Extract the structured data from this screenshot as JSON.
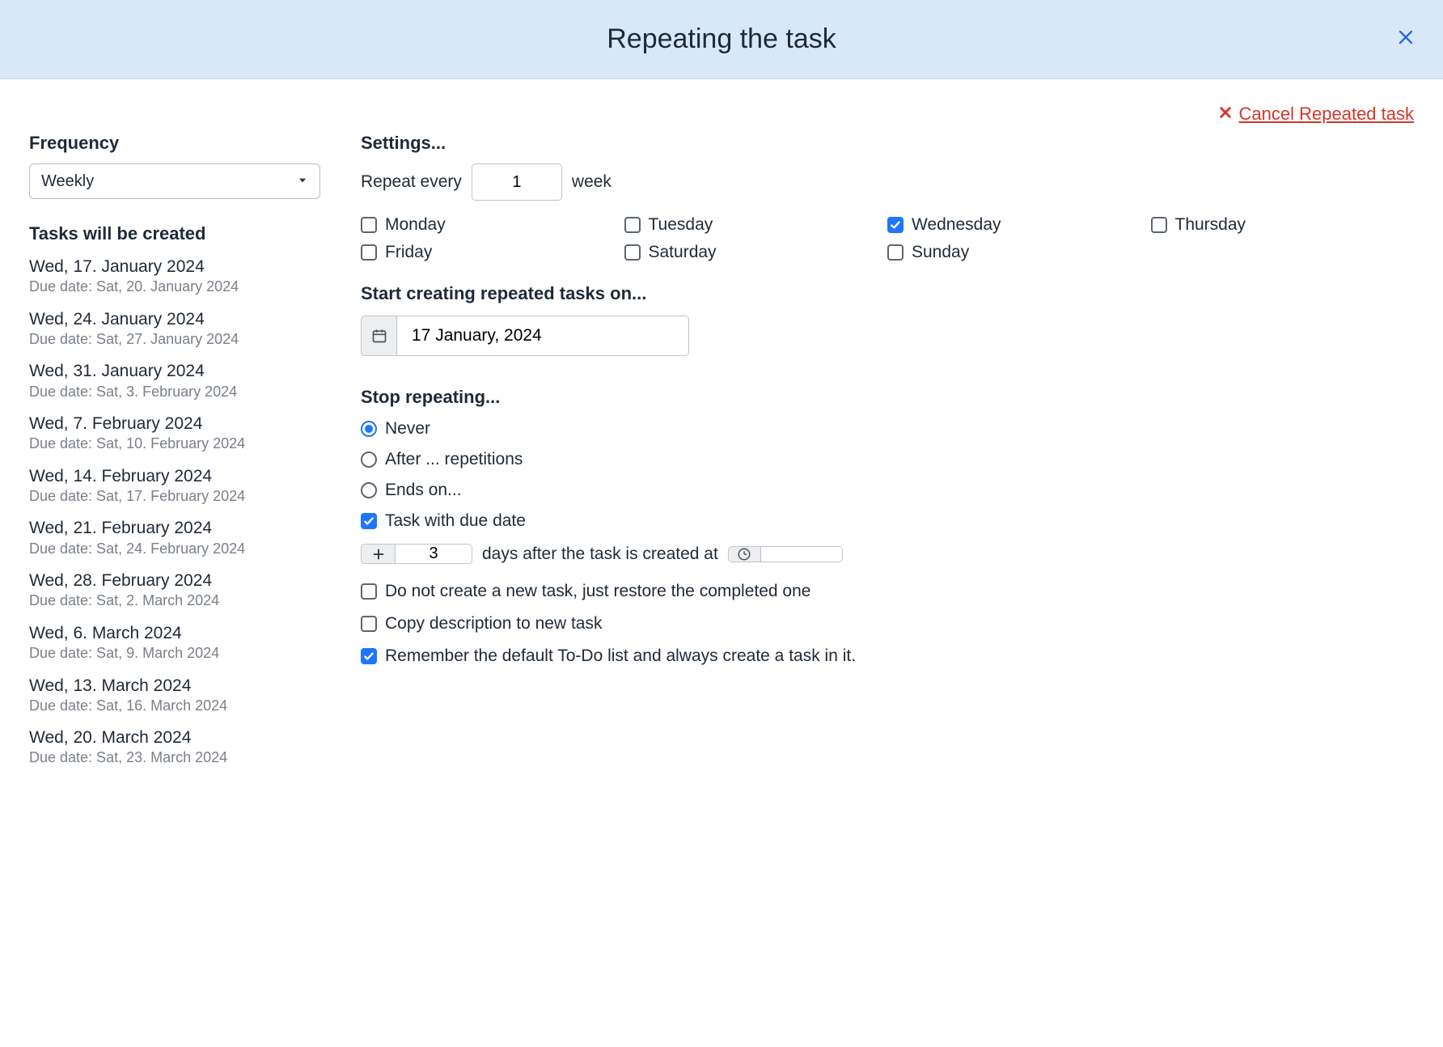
{
  "header": {
    "title": "Repeating the task"
  },
  "cancel_link": "Cancel Repeated task",
  "frequency": {
    "heading": "Frequency",
    "value": "Weekly"
  },
  "preview": {
    "heading": "Tasks will be created",
    "items": [
      {
        "date": "Wed, 17. January 2024",
        "due": "Due date: Sat, 20. January 2024"
      },
      {
        "date": "Wed, 24. January 2024",
        "due": "Due date: Sat, 27. January 2024"
      },
      {
        "date": "Wed, 31. January 2024",
        "due": "Due date: Sat, 3. February 2024"
      },
      {
        "date": "Wed, 7. February 2024",
        "due": "Due date: Sat, 10. February 2024"
      },
      {
        "date": "Wed, 14. February 2024",
        "due": "Due date: Sat, 17. February 2024"
      },
      {
        "date": "Wed, 21. February 2024",
        "due": "Due date: Sat, 24. February 2024"
      },
      {
        "date": "Wed, 28. February 2024",
        "due": "Due date: Sat, 2. March 2024"
      },
      {
        "date": "Wed, 6. March 2024",
        "due": "Due date: Sat, 9. March 2024"
      },
      {
        "date": "Wed, 13. March 2024",
        "due": "Due date: Sat, 16. March 2024"
      },
      {
        "date": "Wed, 20. March 2024",
        "due": "Due date: Sat, 23. March 2024"
      }
    ]
  },
  "settings": {
    "heading": "Settings...",
    "repeat_prefix": "Repeat every",
    "repeat_value": "1",
    "repeat_suffix": "week",
    "days": [
      {
        "label": "Monday",
        "checked": false
      },
      {
        "label": "Tuesday",
        "checked": false
      },
      {
        "label": "Wednesday",
        "checked": true
      },
      {
        "label": "Thursday",
        "checked": false
      },
      {
        "label": "Friday",
        "checked": false
      },
      {
        "label": "Saturday",
        "checked": false
      },
      {
        "label": "Sunday",
        "checked": false
      }
    ],
    "start_heading": "Start creating repeated tasks on...",
    "start_date": "17 January, 2024",
    "stop_heading": "Stop repeating...",
    "stop_options": {
      "never": "Never",
      "after": "After ... repetitions",
      "ends": "Ends on..."
    },
    "stop_selected": "never",
    "due": {
      "checkbox_label": "Task with due date",
      "checked": true,
      "days_value": "3",
      "middle_text": "days after the task is created at",
      "time_value": ""
    },
    "options": [
      {
        "label": "Do not create a new task, just restore the completed one",
        "checked": false
      },
      {
        "label": "Copy description to new task",
        "checked": false
      },
      {
        "label": "Remember the default To-Do list and always create a task in it.",
        "checked": true
      }
    ]
  }
}
